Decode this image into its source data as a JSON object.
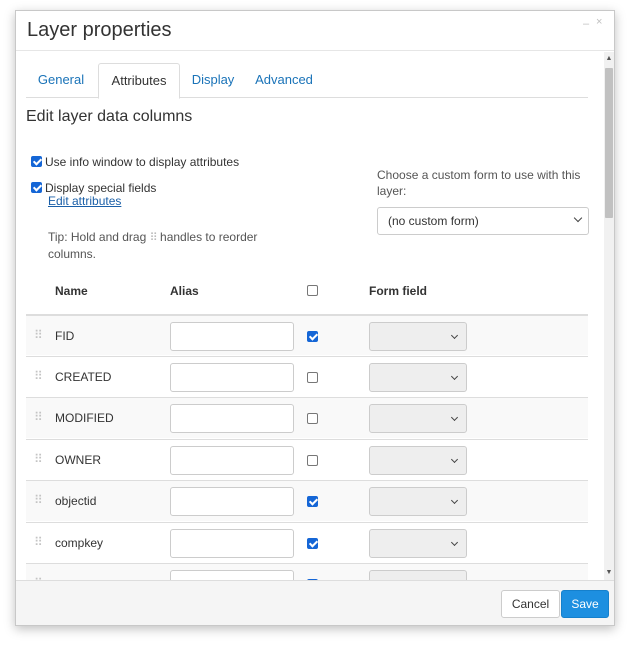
{
  "dialog": {
    "title": "Layer properties",
    "minimize_glyph": "–",
    "close_glyph": "×"
  },
  "tabs": [
    {
      "label": "General",
      "active": false
    },
    {
      "label": "Attributes",
      "active": true
    },
    {
      "label": "Display",
      "active": false
    },
    {
      "label": "Advanced",
      "active": false
    }
  ],
  "section_title": "Edit layer data columns",
  "options": {
    "use_info_window": {
      "label": "Use info window to display attributes",
      "checked": true
    },
    "display_special": {
      "label": "Display special fields",
      "checked": true
    }
  },
  "edit_attributes_link": "Edit attributes",
  "tip": {
    "before": "Tip: Hold and drag",
    "after": "handles to reorder columns."
  },
  "custom_form": {
    "label": "Choose a custom form to use with this layer:",
    "selected": "(no custom form)"
  },
  "table": {
    "headers": {
      "name": "Name",
      "alias": "Alias",
      "form_field": "Form field"
    },
    "header_checkbox_checked": false,
    "rows": [
      {
        "name": "FID",
        "alias": "",
        "visible": true
      },
      {
        "name": "CREATED",
        "alias": "",
        "visible": false
      },
      {
        "name": "MODIFIED",
        "alias": "",
        "visible": false
      },
      {
        "name": "OWNER",
        "alias": "",
        "visible": false
      },
      {
        "name": "objectid",
        "alias": "",
        "visible": true
      },
      {
        "name": "compkey",
        "alias": "",
        "visible": true
      },
      {
        "name": "",
        "alias": "",
        "visible": true
      }
    ]
  },
  "footer": {
    "cancel_label": "Cancel",
    "save_label": "Save"
  },
  "icons": {
    "grip": "drag-handle-icon",
    "chevron": "chevron-down-icon",
    "checkbox": "checkbox-icon"
  },
  "colors": {
    "accent": "#1d8fe0",
    "link": "#1a73b8",
    "checkbox": "#1566d6"
  }
}
